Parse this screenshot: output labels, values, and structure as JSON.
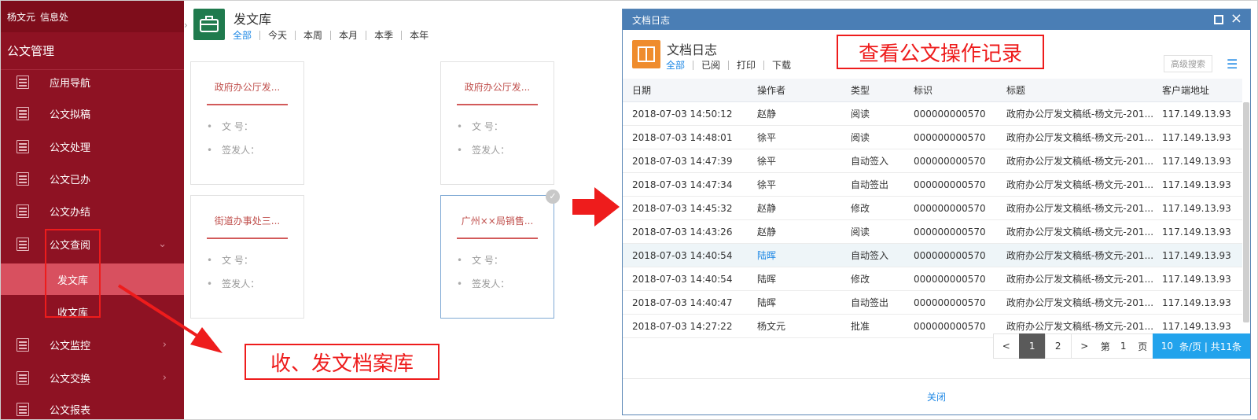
{
  "sidebar": {
    "user_name": "杨文元",
    "department": "信息处",
    "section_title": "公文管理",
    "items": [
      {
        "label": "应用导航",
        "has_chevron": false
      },
      {
        "label": "公文拟稿",
        "has_chevron": false
      },
      {
        "label": "公文处理",
        "has_chevron": false
      },
      {
        "label": "公文已办",
        "has_chevron": false
      },
      {
        "label": "公文办结",
        "has_chevron": false
      },
      {
        "label": "公文查阅",
        "has_chevron": true,
        "chevron": "⌄"
      },
      {
        "label": "公文监控",
        "has_chevron": true,
        "chevron": "›"
      },
      {
        "label": "公文交换",
        "has_chevron": true,
        "chevron": "›"
      },
      {
        "label": "公文报表",
        "has_chevron": false
      }
    ],
    "subitems": [
      {
        "label": "发文库",
        "active": true
      },
      {
        "label": "收文库",
        "active": false
      }
    ]
  },
  "library": {
    "title": "发文库",
    "toggle_glyph": "›",
    "tabs": [
      "全部",
      "今天",
      "本周",
      "本月",
      "本季",
      "本年"
    ],
    "cards": [
      {
        "title": "政府办公厅发...",
        "doc_no_label": "文 号：",
        "signer_label": "签发人：",
        "selected": false
      },
      {
        "title": "政府办公厅发...",
        "doc_no_label": "文 号：",
        "signer_label": "签发人：",
        "selected": false
      },
      {
        "title": "街道办事处三...",
        "doc_no_label": "文 号：",
        "signer_label": "签发人：",
        "selected": false
      },
      {
        "title": "广州××局销售...",
        "doc_no_label": "文 号：",
        "signer_label": "签发人：",
        "selected": true
      }
    ]
  },
  "annotations": {
    "archive_label": "收、发文档案库",
    "log_label": "查看公文操作记录",
    "color": "#ee1c1c"
  },
  "dialog": {
    "window_title": "文档日志",
    "close_glyph": "×",
    "header_title": "文档日志",
    "tabs": [
      "全部",
      "已阅",
      "打印",
      "下载"
    ],
    "advanced_search": "高级搜索",
    "list_icon_glyph": "☰",
    "columns": [
      "日期",
      "操作者",
      "类型",
      "标识",
      "标题",
      "客户端地址"
    ],
    "rows": [
      {
        "date": "2018-07-03 14:50:12",
        "operator": "赵静",
        "type": "阅读",
        "id": "000000000570",
        "title": "政府办公厅发文稿纸-杨文元-201...",
        "ip": "117.149.13.93",
        "highlight": false
      },
      {
        "date": "2018-07-03 14:48:01",
        "operator": "徐平",
        "type": "阅读",
        "id": "000000000570",
        "title": "政府办公厅发文稿纸-杨文元-201...",
        "ip": "117.149.13.93",
        "highlight": false
      },
      {
        "date": "2018-07-03 14:47:39",
        "operator": "徐平",
        "type": "自动签入",
        "id": "000000000570",
        "title": "政府办公厅发文稿纸-杨文元-201...",
        "ip": "117.149.13.93",
        "highlight": false
      },
      {
        "date": "2018-07-03 14:47:34",
        "operator": "徐平",
        "type": "自动签出",
        "id": "000000000570",
        "title": "政府办公厅发文稿纸-杨文元-201...",
        "ip": "117.149.13.93",
        "highlight": false
      },
      {
        "date": "2018-07-03 14:45:32",
        "operator": "赵静",
        "type": "修改",
        "id": "000000000570",
        "title": "政府办公厅发文稿纸-杨文元-201...",
        "ip": "117.149.13.93",
        "highlight": false
      },
      {
        "date": "2018-07-03 14:43:26",
        "operator": "赵静",
        "type": "阅读",
        "id": "000000000570",
        "title": "政府办公厅发文稿纸-杨文元-201...",
        "ip": "117.149.13.93",
        "highlight": false
      },
      {
        "date": "2018-07-03 14:40:54",
        "operator": "陆晖",
        "type": "自动签入",
        "id": "000000000570",
        "title": "政府办公厅发文稿纸-杨文元-201...",
        "ip": "117.149.13.93",
        "highlight": true
      },
      {
        "date": "2018-07-03 14:40:54",
        "operator": "陆晖",
        "type": "修改",
        "id": "000000000570",
        "title": "政府办公厅发文稿纸-杨文元-201...",
        "ip": "117.149.13.93",
        "highlight": false
      },
      {
        "date": "2018-07-03 14:40:47",
        "operator": "陆晖",
        "type": "自动签出",
        "id": "000000000570",
        "title": "政府办公厅发文稿纸-杨文元-201...",
        "ip": "117.149.13.93",
        "highlight": false
      },
      {
        "date": "2018-07-03 14:27:22",
        "operator": "杨文元",
        "type": "批准",
        "id": "000000000570",
        "title": "政府办公厅发文稿纸-杨文元-201...",
        "ip": "117.149.13.93",
        "highlight": false
      }
    ],
    "pager": {
      "prev": "<",
      "pages": [
        "1",
        "2"
      ],
      "current": "1",
      "next": ">",
      "goto_prefix": "第",
      "goto_value": "1",
      "goto_suffix": "页",
      "per_page": "10",
      "per_page_text": "条/页 | 共11条"
    },
    "footer_close": "关闭"
  }
}
